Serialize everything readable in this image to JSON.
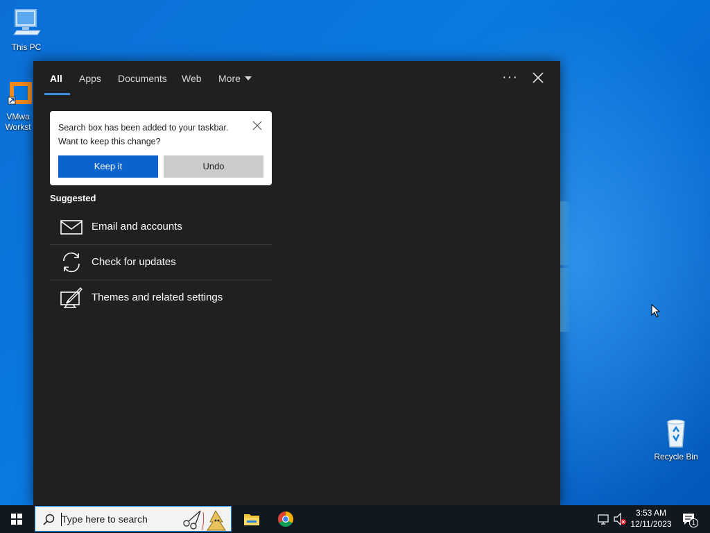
{
  "desktop": {
    "icons": [
      {
        "name": "This PC"
      },
      {
        "name": "VMwa\nWorkst"
      },
      {
        "name": "Recycle Bin"
      }
    ]
  },
  "search_panel": {
    "tabs": [
      {
        "label": "All",
        "active": true
      },
      {
        "label": "Apps"
      },
      {
        "label": "Documents"
      },
      {
        "label": "Web"
      },
      {
        "label": "More"
      }
    ],
    "more_options_label": "···",
    "notice": {
      "line1": "Search box has been added to your taskbar.",
      "line2": "Want to keep this change?",
      "keep_label": "Keep it",
      "undo_label": "Undo"
    },
    "suggested_heading": "Suggested",
    "suggestions": [
      {
        "label": "Email and accounts",
        "icon": "mail-icon"
      },
      {
        "label": "Check for updates",
        "icon": "sync-icon"
      },
      {
        "label": "Themes and related settings",
        "icon": "theme-brush-icon"
      }
    ]
  },
  "taskbar": {
    "search_placeholder": "Type here to search",
    "pinned": [
      {
        "icon": "file-explorer-icon"
      },
      {
        "icon": "chrome-icon"
      }
    ],
    "clock": {
      "time": "3:53 AM",
      "date": "12/11/2023"
    },
    "notification_count": "1"
  },
  "colors": {
    "accent": "#0b63ce",
    "panel_bg": "#202020",
    "taskbar_bg": "#101820"
  }
}
